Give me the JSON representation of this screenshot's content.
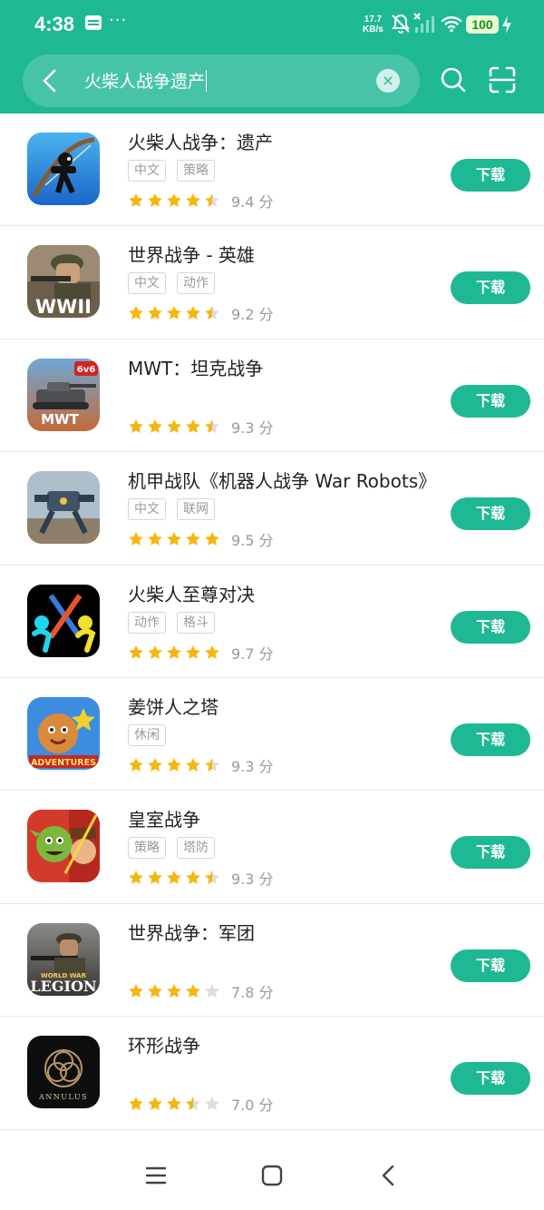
{
  "status_bar": {
    "time": "4:38",
    "speed_value": "17.7",
    "speed_unit": "KB/s",
    "battery": "100"
  },
  "search": {
    "query": "火柴人战争遗产"
  },
  "apps": [
    {
      "name": "火柴人战争：遗产",
      "tags": [
        "中文",
        "策略"
      ],
      "rating": 4.5,
      "score": "9.4 分",
      "action": "下载",
      "icon": "stickman-archer-icon"
    },
    {
      "name": "世界战争 - 英雄",
      "tags": [
        "中文",
        "动作"
      ],
      "rating": 4.5,
      "score": "9.2 分",
      "action": "下载",
      "icon": "wwii-soldier-icon",
      "icon_text": "WWII"
    },
    {
      "name": "MWT：坦克战争",
      "tags": [],
      "rating": 4.5,
      "score": "9.3 分",
      "action": "下载",
      "icon": "tank-icon",
      "icon_text": "MWT",
      "icon_badge": "6v6"
    },
    {
      "name": "机甲战队《机器人战争 War Robots》",
      "tags": [
        "中文",
        "联网"
      ],
      "rating": 5,
      "score": "9.5 分",
      "action": "下载",
      "icon": "mech-robot-icon"
    },
    {
      "name": "火柴人至尊对决",
      "tags": [
        "动作",
        "格斗"
      ],
      "rating": 5,
      "score": "9.7 分",
      "action": "下载",
      "icon": "stickman-duel-icon"
    },
    {
      "name": "姜饼人之塔",
      "tags": [
        "休闲"
      ],
      "rating": 4.5,
      "score": "9.3 分",
      "action": "下载",
      "icon": "gingerbread-cookie-icon",
      "icon_text": "ADVENTURES"
    },
    {
      "name": "皇室战争",
      "tags": [
        "策略",
        "塔防"
      ],
      "rating": 4.5,
      "score": "9.3 分",
      "action": "下载",
      "icon": "goblin-warrior-icon"
    },
    {
      "name": "世界战争：军团",
      "tags": [],
      "rating": 4,
      "score": "7.8 分",
      "action": "下载",
      "icon": "world-war-legion-icon",
      "icon_text": "LEGION",
      "icon_subtext": "WORLD WAR"
    },
    {
      "name": "环形战争",
      "tags": [],
      "rating": 3.5,
      "score": "7.0 分",
      "action": "下载",
      "icon": "annulus-icon",
      "icon_text": "ANNULUS"
    }
  ],
  "colors": {
    "accent": "#1fb894",
    "star": "#f5b70f",
    "star_empty": "#dddddd"
  }
}
